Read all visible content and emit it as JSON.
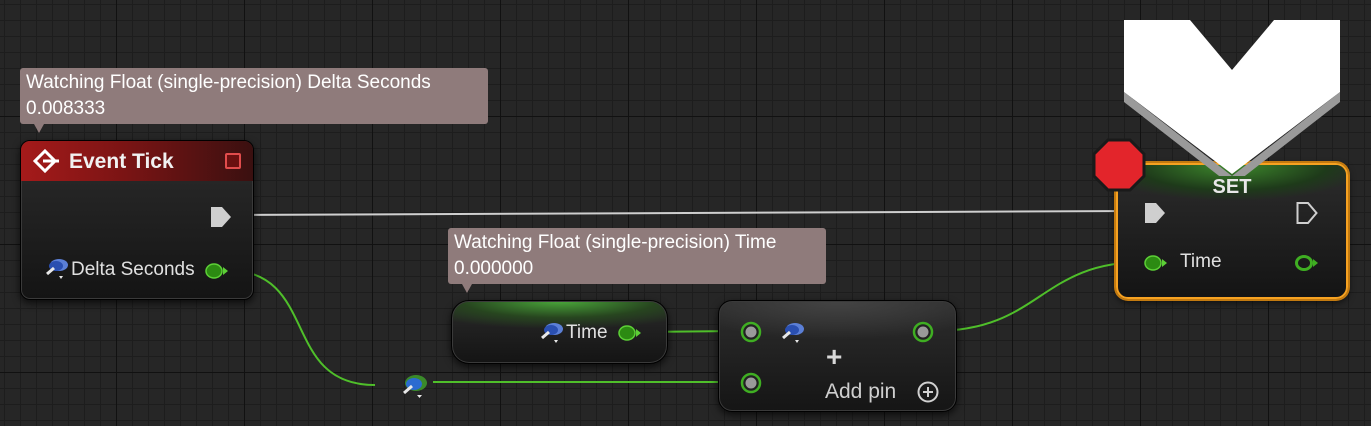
{
  "watch_bubbles": {
    "delta": {
      "title": "Watching Float (single-precision) Delta Seconds",
      "value": "0.008333"
    },
    "time": {
      "title": "Watching Float (single-precision) Time",
      "value": "0.000000"
    }
  },
  "event_tick": {
    "title": "Event Tick",
    "delta_label": "Delta Seconds"
  },
  "get_time": {
    "label": "Time"
  },
  "add": {
    "add_pin_label": "Add pin",
    "plus_glyph": "+"
  },
  "set_node": {
    "title": "SET",
    "time_label": "Time"
  },
  "colors": {
    "exec_wire": "#cfcfcf",
    "float_wire": "#4fbf2a",
    "event_red": "#a51a1a",
    "selection": "#f7a221",
    "breakpoint": "#e3252b"
  }
}
